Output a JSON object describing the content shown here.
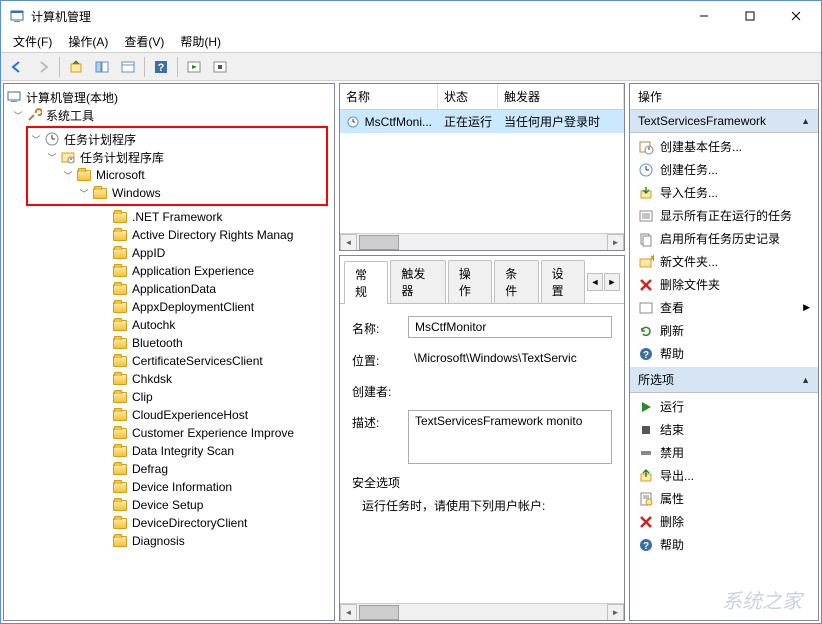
{
  "window": {
    "title": "计算机管理"
  },
  "menubar": [
    "文件(F)",
    "操作(A)",
    "查看(V)",
    "帮助(H)"
  ],
  "tree": {
    "root": {
      "label": "计算机管理(本地)"
    },
    "system_tools": {
      "label": "系统工具"
    },
    "highlighted": {
      "task_scheduler": "任务计划程序",
      "task_scheduler_library": "任务计划程序库",
      "microsoft": "Microsoft",
      "windows": "Windows"
    },
    "windows_children": [
      ".NET Framework",
      "Active Directory Rights Manag",
      "AppID",
      "Application Experience",
      "ApplicationData",
      "AppxDeploymentClient",
      "Autochk",
      "Bluetooth",
      "CertificateServicesClient",
      "Chkdsk",
      "Clip",
      "CloudExperienceHost",
      "Customer Experience Improve",
      "Data Integrity Scan",
      "Defrag",
      "Device Information",
      "Device Setup",
      "DeviceDirectoryClient",
      "Diagnosis"
    ]
  },
  "task_list": {
    "columns": {
      "name": "名称",
      "status": "状态",
      "triggers": "触发器"
    },
    "row": {
      "name": "MsCtfMoni...",
      "status": "正在运行",
      "triggers": "当任何用户登录时"
    }
  },
  "tabs": [
    "常规",
    "触发器",
    "操作",
    "条件",
    "设置"
  ],
  "detail": {
    "name_label": "名称:",
    "name_value": "MsCtfMonitor",
    "location_label": "位置:",
    "location_value": "\\Microsoft\\Windows\\TextServic",
    "creator_label": "创建者:",
    "description_label": "描述:",
    "description_value": "TextServicesFramework monito",
    "security_options_label": "安全选项",
    "run_as_label": "运行任务时，请使用下列用户帐户:"
  },
  "actions": {
    "header": "操作",
    "group1_title": "TextServicesFramework",
    "group1_items": [
      {
        "icon": "task-basic",
        "label": "创建基本任务..."
      },
      {
        "icon": "task-create",
        "label": "创建任务..."
      },
      {
        "icon": "import",
        "label": "导入任务..."
      },
      {
        "icon": "show-running",
        "label": "显示所有正在运行的任务"
      },
      {
        "icon": "enable-history",
        "label": "启用所有任务历史记录"
      },
      {
        "icon": "new-folder",
        "label": "新文件夹..."
      },
      {
        "icon": "delete-red",
        "label": "删除文件夹"
      },
      {
        "icon": "view",
        "label": "查看",
        "submenu": true
      },
      {
        "icon": "refresh",
        "label": "刷新"
      },
      {
        "icon": "help",
        "label": "帮助"
      }
    ],
    "group2_title": "所选项",
    "group2_items": [
      {
        "icon": "run",
        "label": "运行"
      },
      {
        "icon": "end",
        "label": "结束"
      },
      {
        "icon": "disable",
        "label": "禁用"
      },
      {
        "icon": "export",
        "label": "导出..."
      },
      {
        "icon": "properties",
        "label": "属性"
      },
      {
        "icon": "delete-red",
        "label": "删除"
      },
      {
        "icon": "help",
        "label": "帮助"
      }
    ]
  },
  "watermark": "系统之家"
}
